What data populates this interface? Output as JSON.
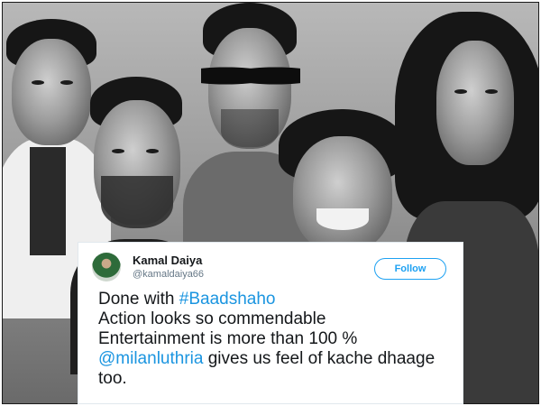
{
  "tweet": {
    "user": {
      "name": "Kamal Daiya",
      "handle": "@kamaldaiya66",
      "avatar_icon": "user-avatar"
    },
    "follow_label": "Follow",
    "lines": [
      {
        "prefix": "Done with ",
        "link": "#Baadshaho",
        "suffix": ""
      },
      {
        "prefix": "Action looks so commendable",
        "link": "",
        "suffix": ""
      },
      {
        "prefix": "Entertainment is more than 100 %",
        "link": "",
        "suffix": ""
      },
      {
        "prefix": "",
        "link": "@milanluthria",
        "suffix": " gives us feel of kache dhaage"
      },
      {
        "prefix": "too.",
        "link": "",
        "suffix": ""
      }
    ],
    "link_color": "#1b95e0",
    "follow_color": "#1da1f2"
  },
  "background": {
    "style": "black-and-white photo collage of five people"
  }
}
